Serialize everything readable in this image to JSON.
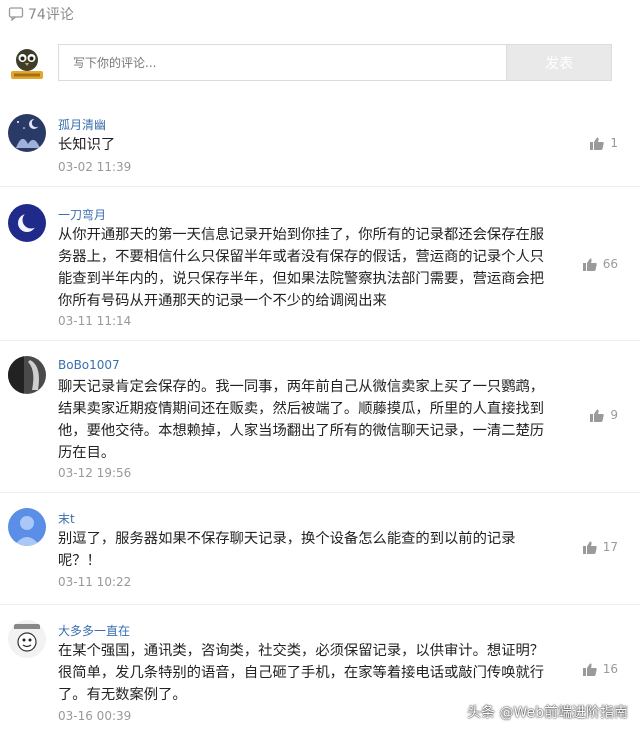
{
  "header": {
    "comment_count_label": "74评论",
    "icon": "comment-icon"
  },
  "composer": {
    "placeholder": "写下你的评论...",
    "send_label": "发表"
  },
  "comments": [
    {
      "username": "孤月清幽",
      "text": "长知识了",
      "time": "03-02 11:39",
      "likes": "1"
    },
    {
      "username": "一刀弯月",
      "text": "从你开通那天的第一天信息记录开始到你挂了，你所有的记录都还会保存在服务器上，不要相信什么只保留半年或者没有保存的假话，营运商的记录个人只能查到半年内的，说只保存半年，但如果法院警察执法部门需要，营运商会把你所有号码从开通那天的记录一个不少的给调阅出来",
      "time": "03-11 11:14",
      "likes": "66"
    },
    {
      "username": "BoBo1007",
      "text": "聊天记录肯定会保存的。我一同事，两年前自己从微信卖家上买了一只鹦鹉，结果卖家近期疫情期间还在贩卖，然后被端了。顺藤摸瓜，所里的人直接找到他，要他交待。本想赖掉，人家当场翻出了所有的微信聊天记录，一清二楚历历在目。",
      "time": "03-12 19:56",
      "likes": "9"
    },
    {
      "username": "末t",
      "text": "别逗了，服务器如果不保存聊天记录，换个设备怎么能查的到以前的记录呢？！",
      "time": "03-11 10:22",
      "likes": "17"
    },
    {
      "username": "大多多一直在",
      "text": "在某个强国，通讯类，咨询类，社交类，必须保留记录，以供审计。想证明？很简单，发几条特别的语音，自己砸了手机，在家等着接电话或敲门传唤就行了。有无数案例了。",
      "time": "03-16 00:39",
      "likes": "16"
    }
  ],
  "watermark": "头条 @Web前端进阶指南"
}
